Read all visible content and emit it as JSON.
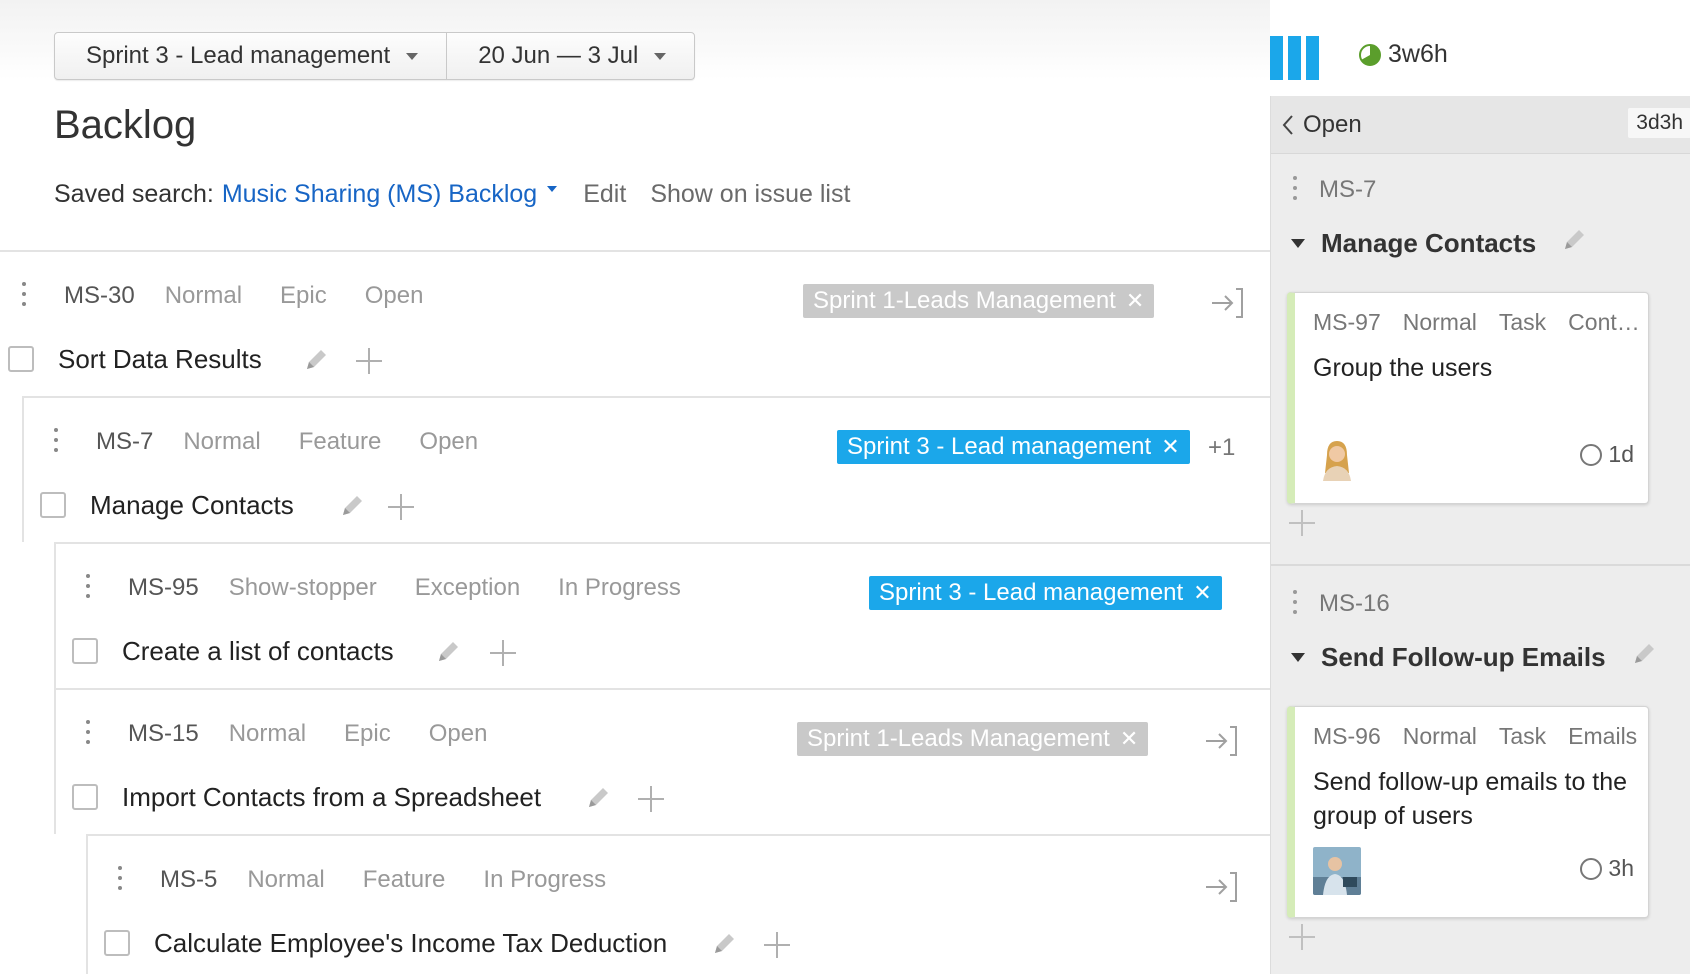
{
  "header": {
    "sprint_selector": "Sprint 3 - Lead management",
    "date_range": "20 Jun — 3 Jul",
    "estimate_total": "3w6h",
    "colors": {
      "accent": "#1ba7ea",
      "link": "#1765c5"
    }
  },
  "page": {
    "title": "Backlog",
    "saved_search_label": "Saved search:",
    "saved_search_name": "Music Sharing (MS) Backlog",
    "edit_label": "Edit",
    "show_on_issue_list_label": "Show on issue list"
  },
  "issues": [
    {
      "id": "MS-30",
      "priority": "Normal",
      "type": "Epic",
      "state": "Open",
      "summary": "Sort Data Results",
      "sprint_tag": "Sprint 1-Leads Management",
      "tag_color": "grey",
      "extra": ""
    },
    {
      "id": "MS-7",
      "priority": "Normal",
      "type": "Feature",
      "state": "Open",
      "summary": "Manage Contacts",
      "sprint_tag": "Sprint 3 - Lead management",
      "tag_color": "blue",
      "extra": "+1"
    },
    {
      "id": "MS-95",
      "priority": "Show-stopper",
      "type": "Exception",
      "state": "In Progress",
      "summary": "Create a list of contacts",
      "sprint_tag": "Sprint 3 - Lead management",
      "tag_color": "blue",
      "extra": ""
    },
    {
      "id": "MS-15",
      "priority": "Normal",
      "type": "Epic",
      "state": "Open",
      "summary": "Import Contacts from a Spreadsheet",
      "sprint_tag": "Sprint 1-Leads Management",
      "tag_color": "grey",
      "extra": ""
    },
    {
      "id": "MS-5",
      "priority": "Normal",
      "type": "Feature",
      "state": "In Progress",
      "summary": "Calculate Employee's Income Tax Deduction",
      "sprint_tag": "",
      "tag_color": "",
      "extra": ""
    }
  ],
  "board": {
    "column_name": "Open",
    "column_estimate": "3d3h",
    "swimlanes": [
      {
        "id": "MS-7",
        "title": "Manage Contacts",
        "card": {
          "id": "MS-97",
          "priority": "Normal",
          "type": "Task",
          "subsystem": "Cont…",
          "summary": "Group the users",
          "estimate": "1d"
        }
      },
      {
        "id": "MS-16",
        "title": "Send Follow-up Emails",
        "card": {
          "id": "MS-96",
          "priority": "Normal",
          "type": "Task",
          "subsystem": "Emails",
          "summary": "Send follow-up emails to the group of users",
          "estimate": "3h"
        }
      }
    ]
  }
}
